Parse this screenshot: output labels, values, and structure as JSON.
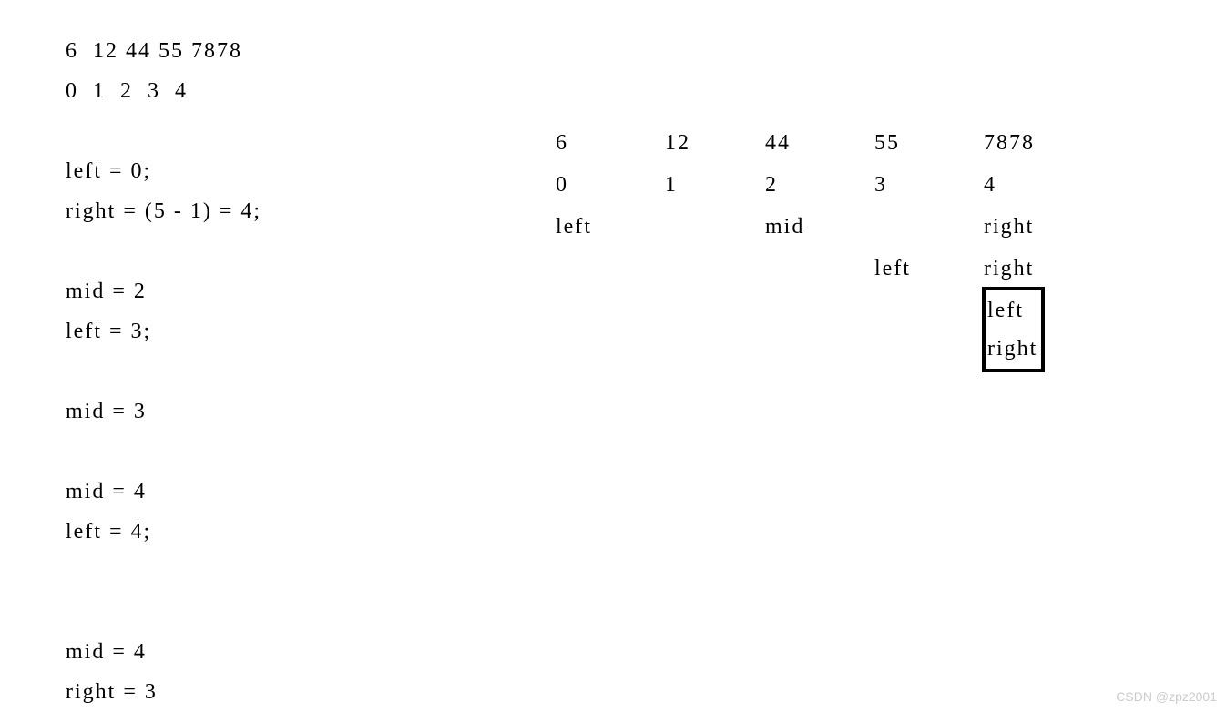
{
  "left": {
    "array_values_line": "6  12 44 55 7878",
    "array_indices_line": "0  1  2  3  4",
    "init_left": "left = 0;",
    "init_right": "right = (5 - 1) = 4;",
    "step1_mid": "mid = 2",
    "step1_left": "left = 3;",
    "step2_mid": "mid = 3",
    "step3_mid": "mid = 4",
    "step3_left": "left = 4;",
    "step4_mid": "mid = 4",
    "step4_right": "right = 3"
  },
  "right": {
    "values": [
      "6",
      "12",
      "44",
      "55",
      "7878"
    ],
    "indices": [
      "0",
      "1",
      "2",
      "3",
      "4"
    ],
    "row1": [
      "left",
      "",
      "mid",
      "",
      "right"
    ],
    "row2": [
      "",
      "",
      "",
      "left",
      "right"
    ],
    "boxed_left": "left",
    "boxed_right": "right"
  },
  "watermark": "CSDN @zpz2001"
}
